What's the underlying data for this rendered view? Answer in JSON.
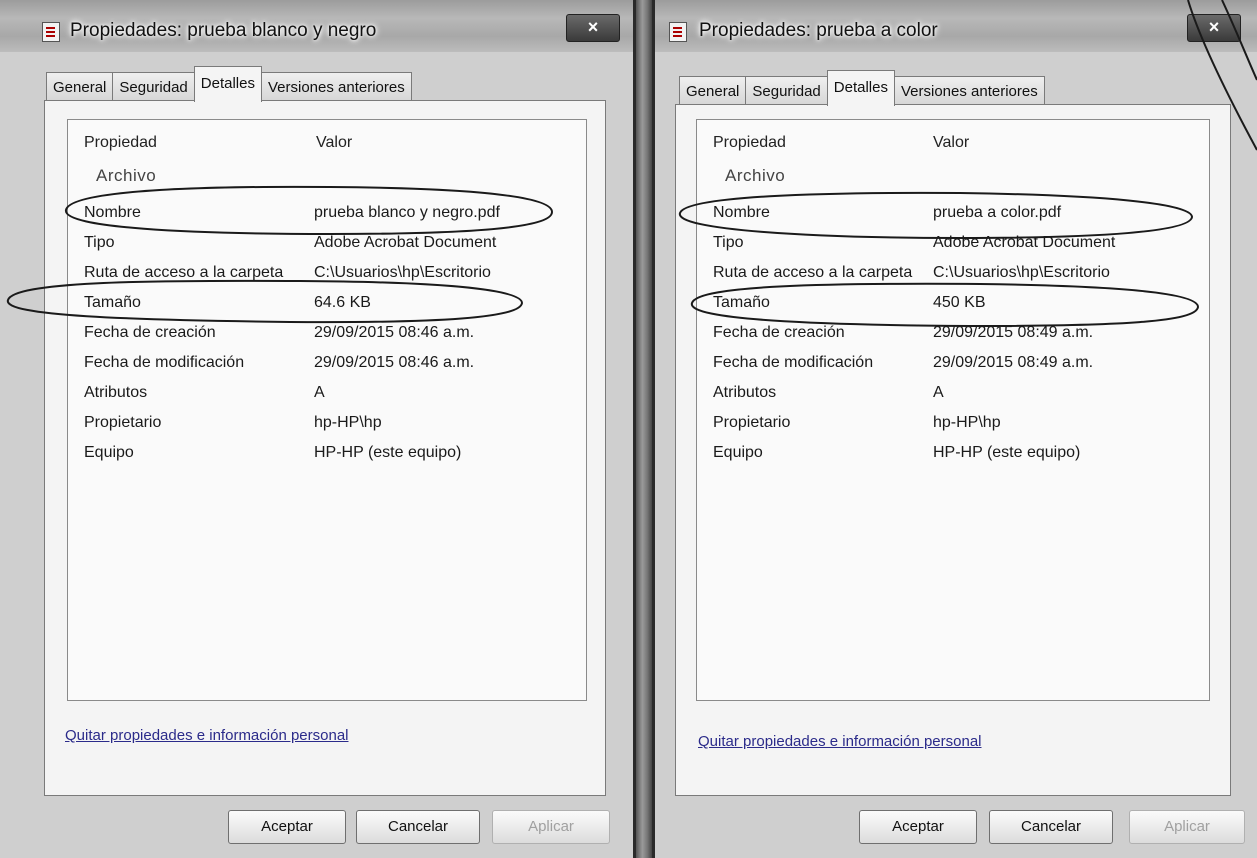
{
  "dialogs": [
    {
      "title": "Propiedades: prueba blanco y negro",
      "close_glyph": "×",
      "tabs": [
        {
          "label": "General"
        },
        {
          "label": "Seguridad"
        },
        {
          "label": "Detalles"
        },
        {
          "label": "Versiones anteriores"
        }
      ],
      "active_tab": "Detalles",
      "columns": {
        "property": "Propiedad",
        "value": "Valor"
      },
      "group": "Archivo",
      "rows": [
        {
          "key": "Nombre",
          "value": "prueba blanco y negro.pdf"
        },
        {
          "key": "Tipo",
          "value": "Adobe Acrobat Document"
        },
        {
          "key": "Ruta de acceso a la carpeta",
          "value": "C:\\Usuarios\\hp\\Escritorio"
        },
        {
          "key": "Tamaño",
          "value": "64.6 KB"
        },
        {
          "key": "Fecha de creación",
          "value": "29/09/2015 08:46 a.m."
        },
        {
          "key": "Fecha de modificación",
          "value": "29/09/2015 08:46 a.m."
        },
        {
          "key": "Atributos",
          "value": "A"
        },
        {
          "key": "Propietario",
          "value": "hp-HP\\hp"
        },
        {
          "key": "Equipo",
          "value": "HP-HP (este equipo)"
        }
      ],
      "remove_link": "Quitar propiedades e información personal",
      "buttons": {
        "ok": "Aceptar",
        "cancel": "Cancelar",
        "apply": "Aplicar"
      }
    },
    {
      "title": "Propiedades: prueba a color",
      "close_glyph": "×",
      "tabs": [
        {
          "label": "General"
        },
        {
          "label": "Seguridad"
        },
        {
          "label": "Detalles"
        },
        {
          "label": "Versiones anteriores"
        }
      ],
      "active_tab": "Detalles",
      "columns": {
        "property": "Propiedad",
        "value": "Valor"
      },
      "group": "Archivo",
      "rows": [
        {
          "key": "Nombre",
          "value": "prueba a color.pdf"
        },
        {
          "key": "Tipo",
          "value": "Adobe Acrobat Document"
        },
        {
          "key": "Ruta de acceso a la carpeta",
          "value": "C:\\Usuarios\\hp\\Escritorio"
        },
        {
          "key": "Tamaño",
          "value": "450 KB"
        },
        {
          "key": "Fecha de creación",
          "value": "29/09/2015 08:49 a.m."
        },
        {
          "key": "Fecha de modificación",
          "value": "29/09/2015 08:49 a.m."
        },
        {
          "key": "Atributos",
          "value": "A"
        },
        {
          "key": "Propietario",
          "value": "hp-HP\\hp"
        },
        {
          "key": "Equipo",
          "value": "HP-HP (este equipo)"
        }
      ],
      "remove_link": "Quitar propiedades e información personal",
      "buttons": {
        "ok": "Aceptar",
        "cancel": "Cancelar",
        "apply": "Aplicar"
      }
    }
  ],
  "annotations": {
    "color": "#1a1a1a",
    "shape": "hand-drawn ellipse",
    "circled_rows": [
      "Nombre",
      "Tamaño"
    ]
  }
}
